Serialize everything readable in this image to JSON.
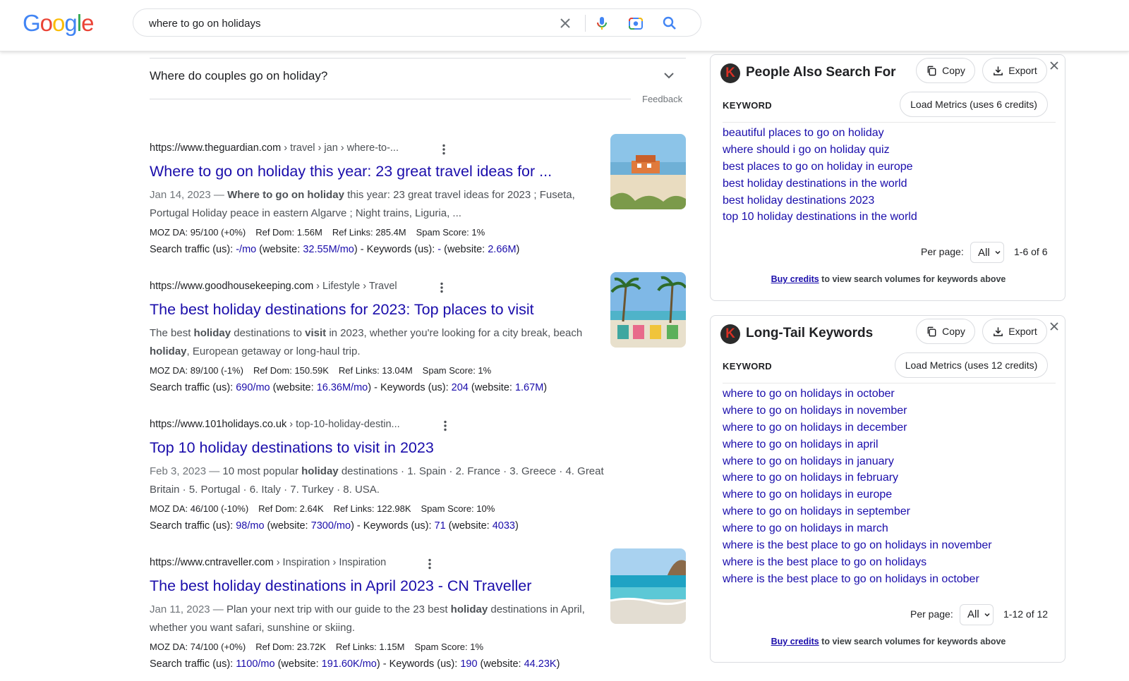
{
  "header": {
    "logo": "Google",
    "logo_colors": [
      "#4285F4",
      "#EA4335",
      "#FBBC05",
      "#4285F4",
      "#34A853",
      "#EA4335"
    ],
    "search_value": "where to go on holidays"
  },
  "faq": {
    "question": "Where do couples go on holiday?",
    "feedback": "Feedback"
  },
  "results": [
    {
      "domain": "https://www.theguardian.com",
      "path": " › travel › jan › where-to-...",
      "title": "Where to go on holiday this year: 23 great travel ideas for ...",
      "date": "Jan 14, 2023 — ",
      "snippet_html": "<b>Where to go on holiday</b> this year: 23 great travel ideas for 2023 ; Fuseta, Portugal Holiday peace in eastern Algarve ; Night trains, Liguria, ...",
      "moz_da": "MOZ DA: 95/100 (+0%)",
      "ref_dom": "Ref Dom: 1.56M",
      "ref_links": "Ref Links: 285.4M",
      "spam": "Spam Score: 1%",
      "traffic_prefix": "Search traffic (us): ",
      "traffic": "-/mo",
      "website_prefix": " (website: ",
      "website_traffic": "32.55M/mo",
      "kw_prefix": ") - Keywords (us): ",
      "kw": "-",
      "kw_web_prefix": " (website: ",
      "kw_web": "2.66M",
      "suffix": ")"
    },
    {
      "domain": "https://www.goodhousekeeping.com",
      "path": " › Lifestyle › Travel",
      "title": "The best holiday destinations for 2023: Top places to visit",
      "date": "",
      "snippet_html": "The best <b>holiday</b> destinations to <b>visit</b> in 2023, whether you're looking for a city break, beach <b>holiday</b>, European getaway or long-haul trip.",
      "moz_da": "MOZ DA: 89/100 (-1%)",
      "ref_dom": "Ref Dom: 150.59K",
      "ref_links": "Ref Links: 13.04M",
      "spam": "Spam Score: 1%",
      "traffic_prefix": "Search traffic (us): ",
      "traffic": "690/mo",
      "website_prefix": " (website: ",
      "website_traffic": "16.36M/mo",
      "kw_prefix": ") - Keywords (us): ",
      "kw": "204",
      "kw_web_prefix": " (website: ",
      "kw_web": "1.67M",
      "suffix": ")"
    },
    {
      "domain": "https://www.101holidays.co.uk",
      "path": " › top-10-holiday-destin...",
      "title": "Top 10 holiday destinations to visit in 2023",
      "date": "Feb 3, 2023 — ",
      "snippet_html": "10 most popular <b>holiday</b> destinations · 1. Spain · 2. France · 3. Greece · 4. Great Britain · 5. Portugal · 6. Italy · 7. Turkey · 8. USA.",
      "moz_da": "MOZ DA: 46/100 (-10%)",
      "ref_dom": "Ref Dom: 2.64K",
      "ref_links": "Ref Links: 122.98K",
      "spam": "Spam Score: 10%",
      "traffic_prefix": "Search traffic (us): ",
      "traffic": "98/mo",
      "website_prefix": " (website: ",
      "website_traffic": "7300/mo",
      "kw_prefix": ") - Keywords (us): ",
      "kw": "71",
      "kw_web_prefix": " (website: ",
      "kw_web": "4033",
      "suffix": ")"
    },
    {
      "domain": "https://www.cntraveller.com",
      "path": " › Inspiration › Inspiration",
      "title": "The best holiday destinations in April 2023 - CN Traveller",
      "date": "Jan 11, 2023 — ",
      "snippet_html": "Plan your next trip with our guide to the 23 best <b>holiday</b> destinations in April, whether you want safari, sunshine or skiing.",
      "moz_da": "MOZ DA: 74/100 (+0%)",
      "ref_dom": "Ref Dom: 23.72K",
      "ref_links": "Ref Links: 1.15M",
      "spam": "Spam Score: 1%",
      "traffic_prefix": "Search traffic (us): ",
      "traffic": "1100/mo",
      "website_prefix": " (website: ",
      "website_traffic": "191.60K/mo",
      "kw_prefix": ") - Keywords (us): ",
      "kw": "190",
      "kw_web_prefix": " (website: ",
      "kw_web": "44.23K",
      "suffix": ")"
    }
  ],
  "widgets": [
    {
      "logo_letter": "K",
      "title": "People Also Search For",
      "copy_label": "Copy",
      "export_label": "Export",
      "col_header": "KEYWORD",
      "metrics_label": "Load Metrics (uses 6 credits)",
      "keywords": [
        "beautiful places to go on holiday",
        "where should i go on holiday quiz",
        "best places to go on holiday in europe",
        "best holiday destinations in the world",
        "best holiday destinations 2023",
        "top 10 holiday destinations in the world"
      ],
      "per_page_label": "Per page:",
      "per_page_value": "All",
      "count": "1-6 of 6",
      "buy_link": "Buy credits",
      "buy_text": " to view search volumes for keywords above"
    },
    {
      "logo_letter": "K",
      "title": "Long-Tail Keywords",
      "copy_label": "Copy",
      "export_label": "Export",
      "col_header": "KEYWORD",
      "metrics_label": "Load Metrics (uses 12 credits)",
      "keywords": [
        "where to go on holidays in october",
        "where to go on holidays in november",
        "where to go on holidays in december",
        "where to go on holidays in april",
        "where to go on holidays in january",
        "where to go on holidays in february",
        "where to go on holidays in europe",
        "where to go on holidays in september",
        "where to go on holidays in march",
        "where is the best place to go on holidays in november",
        "where is the best place to go on holidays",
        "where is the best place to go on holidays in october"
      ],
      "per_page_label": "Per page:",
      "per_page_value": "All",
      "count": "1-12 of 12",
      "buy_link": "Buy credits",
      "buy_text": " to view search volumes for keywords above"
    }
  ],
  "colors": {
    "link": "#1a0dab",
    "text": "#202124",
    "snippet": "#4d5156"
  }
}
